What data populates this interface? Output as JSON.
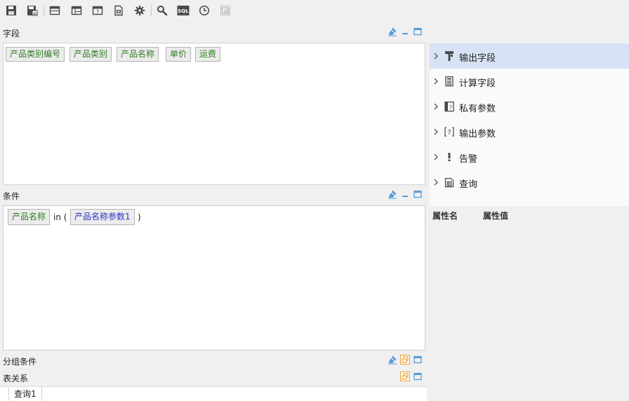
{
  "toolbar": {
    "sql_label": "SQL"
  },
  "sections": {
    "fields": {
      "title": "字段"
    },
    "conditions": {
      "title": "条件"
    },
    "group": {
      "title": "分组条件"
    },
    "relations": {
      "title": "表关系"
    }
  },
  "field_chips": [
    "产品类别编号",
    "产品类别",
    "产品名称",
    "单价",
    "运费"
  ],
  "condition": {
    "field": "产品名称",
    "operator": "in (",
    "param": "产品名称参数1",
    "close": ")"
  },
  "tree": {
    "items": [
      {
        "label": "输出字段",
        "icon": "output-field-icon",
        "selected": true
      },
      {
        "label": "计算字段",
        "icon": "calculator-icon",
        "selected": false
      },
      {
        "label": "私有参数",
        "icon": "private-param-icon",
        "selected": false
      },
      {
        "label": "输出参数",
        "icon": "output-param-icon",
        "selected": false
      },
      {
        "label": "告警",
        "icon": "alert-icon",
        "selected": false
      },
      {
        "label": "查询",
        "icon": "query-icon",
        "selected": false
      }
    ]
  },
  "properties": {
    "name_header": "属性名",
    "value_header": "属性值"
  },
  "bottom_tabs": [
    "查询1"
  ],
  "colors": {
    "chip_text": "#2e7d1f",
    "param_text": "#2436c8",
    "selected_bg": "#d7e3f4",
    "accent_orange": "#e8a33d"
  }
}
